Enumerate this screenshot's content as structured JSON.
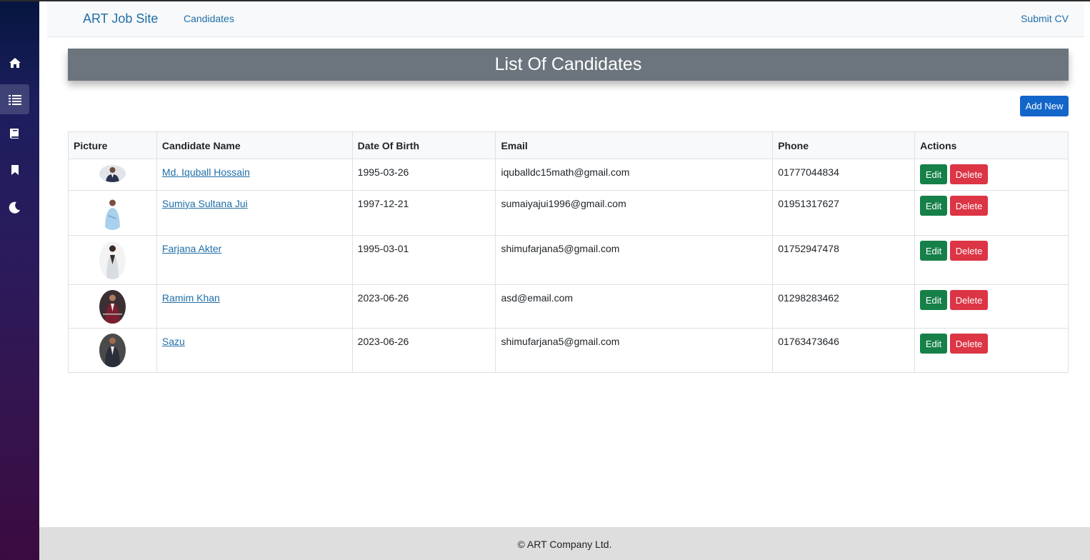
{
  "sidebar": {
    "items": [
      {
        "icon": "home-icon"
      },
      {
        "icon": "list-icon",
        "active": true
      },
      {
        "icon": "book-icon"
      },
      {
        "icon": "bookmark-icon"
      },
      {
        "icon": "moon-icon"
      }
    ]
  },
  "nav": {
    "brand": "ART Job Site",
    "candidates": "Candidates",
    "submit_cv": "Submit CV"
  },
  "page": {
    "title": "List Of Candidates",
    "add_new": "Add New"
  },
  "table": {
    "headers": [
      "Picture",
      "Candidate Name",
      "Date Of Birth",
      "Email",
      "Phone",
      "Actions"
    ],
    "rows": [
      {
        "name": "Md. Iquball Hossain",
        "dob": "1995-03-26",
        "email": "iquballdc15math@gmail.com",
        "phone": "01777044834"
      },
      {
        "name": "Sumiya Sultana Jui",
        "dob": "1997-12-21",
        "email": "sumaiyajui1996@gmail.com",
        "phone": "01951317627"
      },
      {
        "name": "Farjana Akter",
        "dob": "1995-03-01",
        "email": "shimufarjana5@gmail.com",
        "phone": "01752947478"
      },
      {
        "name": "Ramim Khan",
        "dob": "2023-06-26",
        "email": "asd@email.com",
        "phone": "01298283462"
      },
      {
        "name": "Sazu",
        "dob": "2023-06-26",
        "email": "shimufarjana5@gmail.com",
        "phone": "01763473646"
      }
    ],
    "edit_label": "Edit",
    "delete_label": "Delete"
  },
  "footer": {
    "text": "© ART Company Ltd."
  },
  "colors": {
    "link": "#1f6fa8",
    "banner": "#6c757d",
    "add_button": "#1366c9",
    "edit_button": "#168049",
    "delete_button": "#dc3545"
  }
}
